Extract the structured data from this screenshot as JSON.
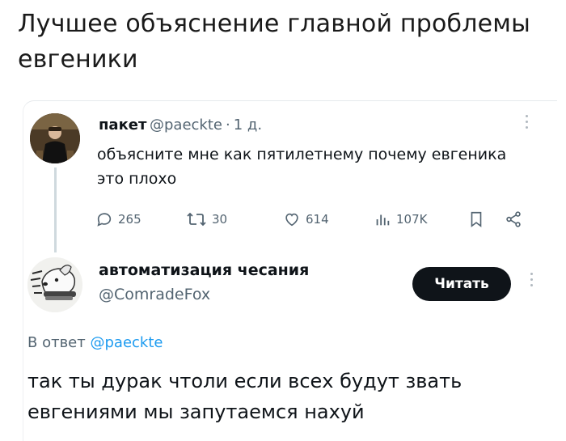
{
  "headline": "Лучшее объяснение главной проблемы евгеники",
  "tweet1": {
    "display_name": "пакет",
    "handle": "@paeckte",
    "separator": "·",
    "time": "1 д.",
    "text": "объясните мне как пятилетнему почему евгеника это плохо",
    "stats": {
      "replies": "265",
      "reposts": "30",
      "likes": "614",
      "views": "107K"
    }
  },
  "tweet2": {
    "display_name": "автоматизация чесания",
    "handle": "@ComradeFox",
    "follow_label": "Читать",
    "reply_prefix": "В ответ",
    "reply_mention": "@paeckte",
    "text": "так ты дурак чтоли если всех будут звать евгениями мы запутаемся нахуй"
  },
  "colors": {
    "secondary_text": "#536471",
    "link": "#1d9bf0",
    "button_bg": "#0f1419"
  },
  "icons": [
    "more-icon",
    "reply-icon",
    "repost-icon",
    "like-icon",
    "views-icon",
    "bookmark-icon",
    "share-icon"
  ]
}
